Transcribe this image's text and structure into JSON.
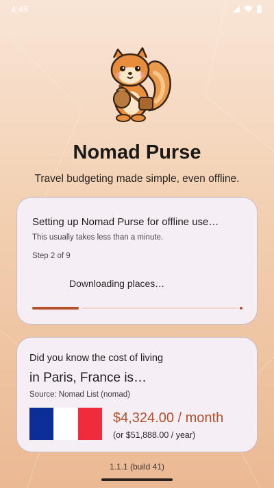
{
  "status_bar": {
    "time": "4:45"
  },
  "app": {
    "title": "Nomad Purse",
    "tagline": "Travel budgeting made simple, even offline."
  },
  "setup": {
    "title": "Setting up Nomad Purse for offline use…",
    "subtitle": "This usually takes less than a minute.",
    "step": "Step 2 of 9",
    "action": "Downloading places…",
    "progress": 0.22
  },
  "fact": {
    "question": "Did you know the cost of living",
    "city_line": "in Paris, France is…",
    "source": "Source: Nomad List (nomad)",
    "monthly_cost": "$4,324.00 / month",
    "yearly_cost": "(or $51,888.00 / year)",
    "flag_colors": [
      "#0a2d96",
      "#ffffff",
      "#ef2b3c"
    ]
  },
  "footer": {
    "version": "1.1.1 (build 41)"
  },
  "colors": {
    "accent": "#b5502b",
    "card_bg": "#f6eef5"
  },
  "icons": [
    "wifi-icon",
    "signal-icon",
    "battery-icon",
    "squirrel-mascot"
  ]
}
